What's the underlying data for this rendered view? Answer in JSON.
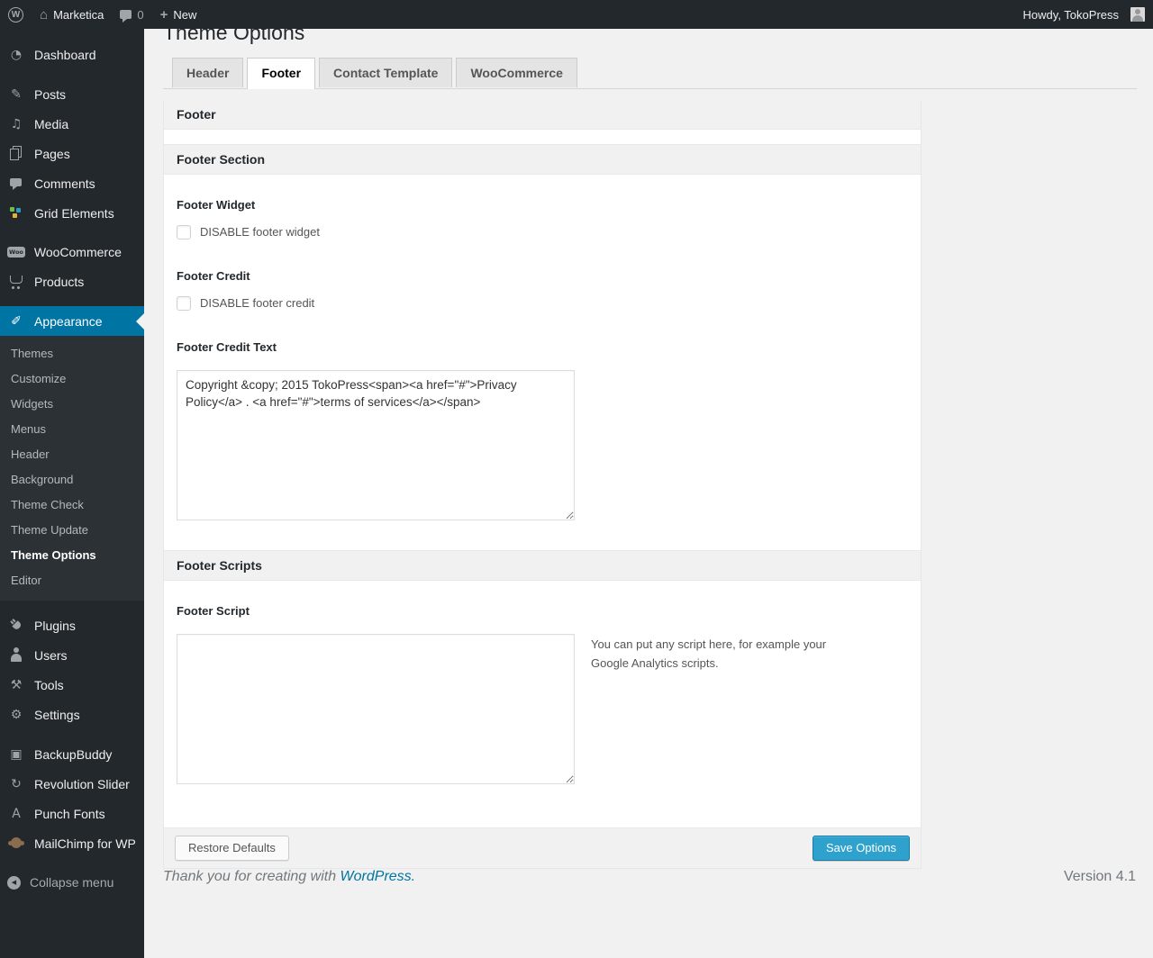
{
  "colors": {
    "accent": "#0074a2",
    "button_blue": "#2ea2cc",
    "dark_bg": "#23282d",
    "page_bg": "#f1f1f1"
  },
  "admin_bar": {
    "wp_logo": "W",
    "site_name": "Marketica",
    "comment_count": "0",
    "new_label": "New",
    "howdy": "Howdy, TokoPress"
  },
  "sidebar": {
    "groups": [
      {
        "items": [
          {
            "label": "Dashboard",
            "icon": "dashboard"
          }
        ]
      },
      {
        "items": [
          {
            "label": "Posts",
            "icon": "posts"
          },
          {
            "label": "Media",
            "icon": "media"
          },
          {
            "label": "Pages",
            "icon": "pages"
          },
          {
            "label": "Comments",
            "icon": "comments"
          },
          {
            "label": "Grid Elements",
            "icon": "grid"
          }
        ]
      },
      {
        "items": [
          {
            "label": "WooCommerce",
            "icon": "woocommerce"
          },
          {
            "label": "Products",
            "icon": "products"
          }
        ]
      },
      {
        "items": [
          {
            "label": "Appearance",
            "icon": "appearance",
            "active": true,
            "submenu": [
              {
                "label": "Themes"
              },
              {
                "label": "Customize"
              },
              {
                "label": "Widgets"
              },
              {
                "label": "Menus"
              },
              {
                "label": "Header"
              },
              {
                "label": "Background"
              },
              {
                "label": "Theme Check"
              },
              {
                "label": "Theme Update"
              },
              {
                "label": "Theme Options",
                "current": true
              },
              {
                "label": "Editor"
              }
            ]
          }
        ]
      },
      {
        "items": [
          {
            "label": "Plugins",
            "icon": "plugins"
          },
          {
            "label": "Users",
            "icon": "users"
          },
          {
            "label": "Tools",
            "icon": "tools"
          },
          {
            "label": "Settings",
            "icon": "settings"
          }
        ]
      },
      {
        "items": [
          {
            "label": "BackupBuddy",
            "icon": "backupbuddy"
          },
          {
            "label": "Revolution Slider",
            "icon": "revslider"
          },
          {
            "label": "Punch Fonts",
            "icon": "punchfonts"
          },
          {
            "label": "MailChimp for WP",
            "icon": "mailchimp"
          }
        ]
      },
      {
        "items": [
          {
            "label": "Collapse menu",
            "icon": "collapse",
            "collapse": true
          }
        ]
      }
    ]
  },
  "page": {
    "title": "Theme Options",
    "tabs": [
      {
        "label": "Header"
      },
      {
        "label": "Footer",
        "active": true
      },
      {
        "label": "Contact Template"
      },
      {
        "label": "WooCommerce"
      }
    ],
    "panel": {
      "heading": "Footer",
      "footer_section": {
        "heading": "Footer Section",
        "footer_widget": {
          "label": "Footer Widget",
          "checkbox_label": "DISABLE footer widget",
          "checked": false
        },
        "footer_credit": {
          "label": "Footer Credit",
          "checkbox_label": "DISABLE footer credit",
          "checked": false
        },
        "footer_credit_text": {
          "label": "Footer Credit Text",
          "value": "Copyright &copy; 2015 TokoPress<span><a href=\"#\">Privacy Policy</a> . <a href=\"#\">terms of services</a></span>"
        }
      },
      "footer_scripts": {
        "heading": "Footer Scripts",
        "footer_script": {
          "label": "Footer Script",
          "value": "",
          "description": "You can put any script here, for example your Google Analytics scripts."
        }
      },
      "actions": {
        "restore": "Restore Defaults",
        "save": "Save Options"
      }
    }
  },
  "footer": {
    "thanks_prefix": "Thank you for creating with ",
    "link": "WordPress.",
    "version": "Version 4.1"
  }
}
